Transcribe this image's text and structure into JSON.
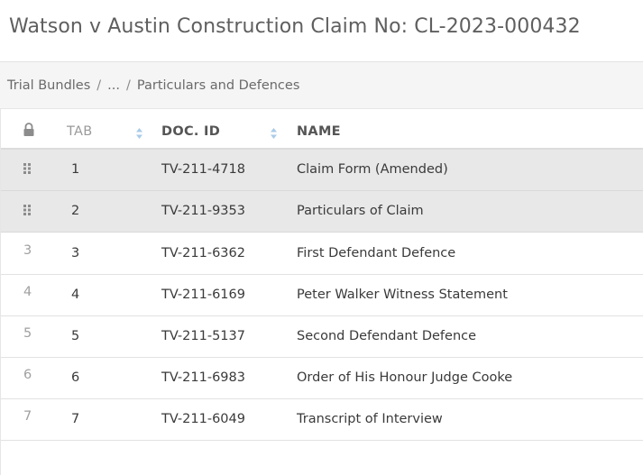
{
  "page": {
    "title": "Watson v Austin Construction Claim No: CL-2023-000432"
  },
  "breadcrumb": {
    "items": [
      "Trial Bundles",
      "...",
      "Particulars and Defences"
    ],
    "separator": "/"
  },
  "table": {
    "headers": {
      "lock_icon": "lock-icon",
      "tab": "TAB",
      "doc_id": "DOC. ID",
      "name": "NAME"
    },
    "rows": [
      {
        "order": "",
        "handle": "drag-handle-icon",
        "tab": "1",
        "doc_id": "TV-211-4718",
        "name": "Claim Form (Amended)",
        "highlighted": true
      },
      {
        "order": "",
        "handle": "drag-handle-icon",
        "tab": "2",
        "doc_id": "TV-211-9353",
        "name": "Particulars of Claim",
        "highlighted": true
      },
      {
        "order": "3",
        "tab": "3",
        "doc_id": "TV-211-6362",
        "name": "First Defendant Defence",
        "highlighted": false
      },
      {
        "order": "4",
        "tab": "4",
        "doc_id": "TV-211-6169",
        "name": "Peter Walker Witness Statement",
        "highlighted": false
      },
      {
        "order": "5",
        "tab": "5",
        "doc_id": "TV-211-5137",
        "name": "Second Defendant Defence",
        "highlighted": false
      },
      {
        "order": "6",
        "tab": "6",
        "doc_id": "TV-211-6983",
        "name": "Order of His Honour Judge Cooke",
        "highlighted": false
      },
      {
        "order": "7",
        "tab": "7",
        "doc_id": "TV-211-6049",
        "name": "Transcript of Interview",
        "highlighted": false
      }
    ]
  },
  "colors": {
    "title": "#5f5f5f",
    "highlight_row": "#e8e8e8",
    "sort_icon": "#a9cbe8"
  }
}
